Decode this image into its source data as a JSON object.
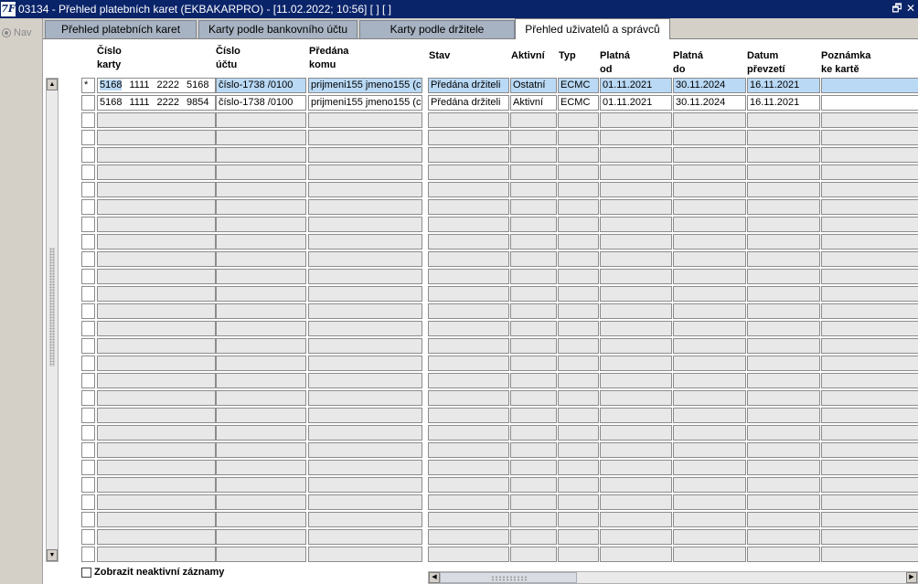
{
  "window": {
    "app_icon_label": "7F",
    "title": "03134 - Přehled platebních karet (EKBAKARPRO) - [11.02.2022; 10:56]  [ ]  [ ]",
    "restore_glyph": "🗗",
    "close_glyph": "✕"
  },
  "nav": {
    "label": "Nav"
  },
  "tabs": [
    {
      "label": "Přehled platebních karet",
      "active": false
    },
    {
      "label": "Karty podle bankovního  účtu",
      "active": false
    },
    {
      "label": "Karty podle držitele",
      "active": false
    },
    {
      "label": "Přehled uživatelů a správců",
      "active": true
    }
  ],
  "columns": {
    "card_number_1": "Číslo",
    "card_number_2": "karty",
    "account": "Číslo účtu",
    "handed_to": "Předána komu",
    "state": "Stav",
    "active": "Aktivní",
    "type": "Typ",
    "valid_from": "Platná od",
    "valid_to": "Platná do",
    "taken_1": "Datum",
    "taken_2": "převzetí",
    "note": "Poznámka ke kartě"
  },
  "rows": [
    {
      "marker": "*",
      "card": [
        "5168",
        "1111",
        "2222",
        "5168"
      ],
      "account": "číslo-1738 /0100",
      "handed_to": "prijmeni155 jmeno155   (c",
      "state": "Předána držiteli",
      "active": "Ostatní",
      "type": "ECMC",
      "valid_from": "01.11.2021",
      "valid_to": "30.11.2024",
      "taken": "16.11.2021",
      "note": ""
    },
    {
      "marker": "",
      "card": [
        "5168",
        "1111",
        "2222",
        "9854"
      ],
      "account": "číslo-1738 /0100",
      "handed_to": "prijmeni155 jmeno155   (c",
      "state": "Předána držiteli",
      "active": "Aktivní",
      "type": "ECMC",
      "valid_from": "01.11.2021",
      "valid_to": "30.11.2024",
      "taken": "16.11.2021",
      "note": ""
    }
  ],
  "empty_row_count": 26,
  "footer": {
    "checkbox_label": "Zobrazit neaktivní záznamy",
    "checked": false
  },
  "colors": {
    "titlebar": "#0a246a",
    "tab_inactive": "#a7b3c2",
    "current_cell": "#b9d9f5",
    "frame": "#d4d0c8"
  }
}
